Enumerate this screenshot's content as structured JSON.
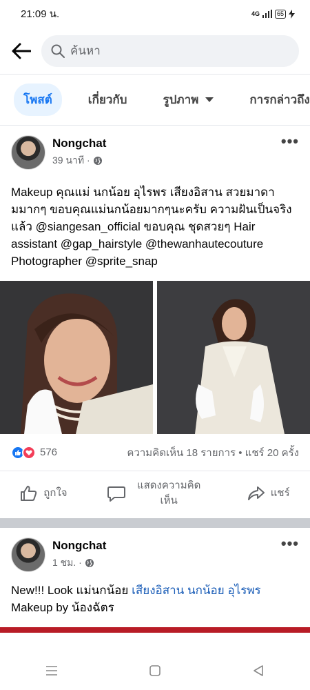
{
  "status_bar": {
    "time": "21:09 น.",
    "network": "4G",
    "battery": "65"
  },
  "search": {
    "placeholder": "ค้นหา"
  },
  "tabs": [
    {
      "label": "โพสต์",
      "active": true
    },
    {
      "label": "เกี่ยวกับ",
      "active": false
    },
    {
      "label": "รูปภาพ",
      "active": false
    },
    {
      "label": "การกล่าวถึง",
      "active": false
    }
  ],
  "post1": {
    "author": "Nongchat",
    "time": "39 นาที ·",
    "text_parts": [
      "Makeup คุณแม่ นกน้อย อุไรพร เสียงอิสาน สวยมาดามมากๆ ขอบคุณแม่นกน้อยมากๆนะครับ ความฝันเป็นจริงแล้ว @siangesan_official ขอบคุณ ชุดสวยๆ Hair assistant @gap_hairstyle @thewanhautecouture Photographer @sprite_snap"
    ],
    "reactions_count": "576",
    "stats": "ความคิดเห็น 18 รายการ • แชร์ 20 ครั้ง",
    "actions": {
      "like": "ถูกใจ",
      "comment": "แสดงความคิดเห็น",
      "share": "แชร์"
    }
  },
  "post2": {
    "author": "Nongchat",
    "time": "1 ชม. ·",
    "text_prefix": "New!!! Look แม่นกน้อย ",
    "text_link": "เสียงอิสาน นกน้อย อุไรพร",
    "text_suffix": "Makeup by น้องฉัตร"
  },
  "colors": {
    "accent": "#1877f2",
    "like": "#1877f2",
    "love": "#f33e58",
    "link": "#1d5fb8"
  },
  "icons": [
    "back-arrow-icon",
    "search-icon",
    "chevron-down-icon",
    "globe-icon",
    "more-icon",
    "like-icon",
    "comment-icon",
    "share-icon",
    "menu-icon",
    "home-square-icon",
    "back-triangle-icon"
  ]
}
